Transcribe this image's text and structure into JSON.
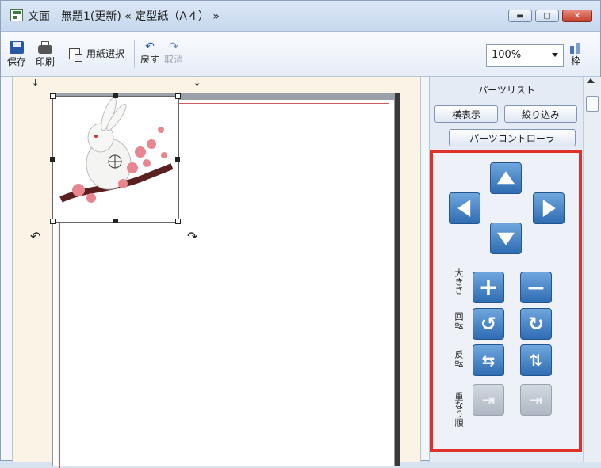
{
  "window": {
    "title": "文面　無題1(更新) « 定型紙（A４） »",
    "minimize_icon": "minimize-icon",
    "maximize_icon": "maximize-icon",
    "close_icon": "close-icon"
  },
  "toolbar": {
    "save_label": "保存",
    "print_label": "印刷",
    "paper_select_label": "用紙選択",
    "undo_label": "戻す",
    "redo_label": "取消",
    "zoom_value": "100%",
    "frame_label": "枠"
  },
  "canvas": {
    "image_alt": "rabbit with cherry blossoms illustration"
  },
  "panel": {
    "title": "パーツリスト",
    "show_button": "横表示",
    "filter_button": "絞り込み",
    "controller_button": "パーツコントローラ",
    "size_label": "大きさ",
    "rotate_label": "回転",
    "flip_label": "反転",
    "order_label": "重なり順"
  },
  "colors": {
    "highlight": "#e0302a",
    "button_blue": "#2e6cb3",
    "canvas_bg": "#fbf4e6"
  }
}
